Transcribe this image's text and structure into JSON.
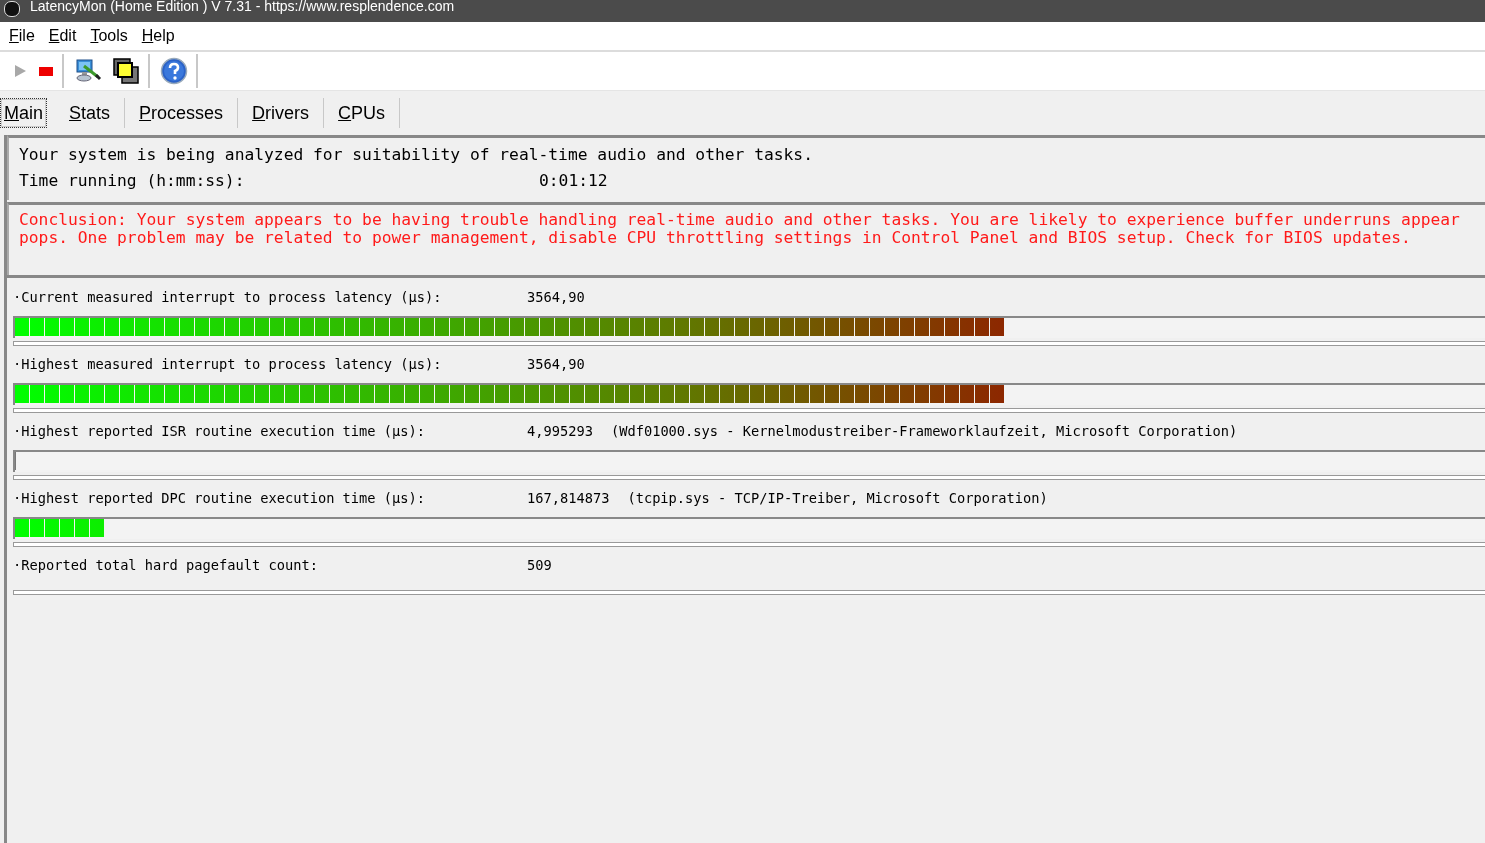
{
  "window": {
    "title": "LatencyMon  (Home Edition )  V 7.31 - https://www.resplendence.com"
  },
  "menu": [
    {
      "label": "File"
    },
    {
      "label": "Edit"
    },
    {
      "label": "Tools"
    },
    {
      "label": "Help"
    }
  ],
  "toolbar": [
    [
      {
        "kind": "play",
        "disabled": true
      },
      {
        "kind": "stop",
        "disabled": false
      }
    ],
    [
      {
        "kind": "monitor"
      },
      {
        "kind": "windows"
      }
    ],
    [
      {
        "kind": "help"
      }
    ]
  ],
  "tabs": [
    {
      "label": "Main",
      "selected": true
    },
    {
      "label": "Stats",
      "selected": false
    },
    {
      "label": "Processes",
      "selected": false
    },
    {
      "label": "Drivers",
      "selected": false
    },
    {
      "label": "CPUs",
      "selected": false
    }
  ],
  "status": {
    "message": "Your system is being analyzed for suitability of real-time audio and other tasks.",
    "time_label": "Time running (h:mm:ss):",
    "time_value": "0:01:12"
  },
  "conclusion": [
    "Conclusion: Your system appears to be having trouble handling real-time audio and other tasks. You are likely to experience buffer underruns appear",
    "pops. One problem may be related to power management, disable CPU throttling settings in Control Panel and BIOS setup. Check for BIOS updates."
  ],
  "metrics": [
    {
      "kind": "meter",
      "label": "·Current measured interrupt to process latency (µs):",
      "value": "3564,90",
      "level": 0.674
    },
    {
      "kind": "meter",
      "label": "·Highest measured interrupt to process latency (µs):",
      "value": "3564,90",
      "level": 0.673
    },
    {
      "kind": "meter",
      "label": "·Highest reported ISR routine execution time (µs):",
      "value": "4,995293",
      "detail": "(Wdf01000.sys - Kernelmodustreiber-Frameworklaufzeit, Microsoft Corporation)",
      "level": 0
    },
    {
      "kind": "meter",
      "label": "·Highest reported DPC routine execution time (µs):",
      "value": "167,814873",
      "detail": "(tcpip.sys - TCP/IP-Treiber, Microsoft Corporation)",
      "level": 0.061
    },
    {
      "kind": "count",
      "label": "·Reported total hard pagefault count:",
      "value": "509"
    }
  ]
}
